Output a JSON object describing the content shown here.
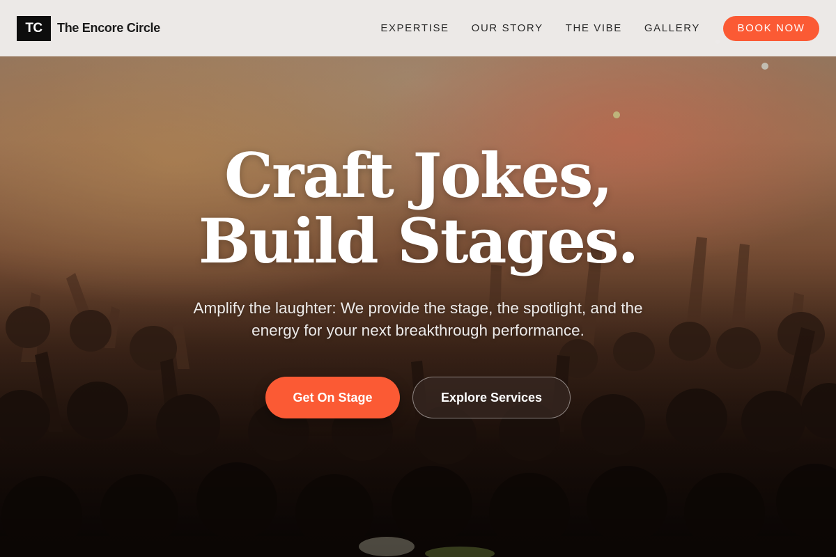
{
  "header": {
    "logo_initials": "TC",
    "brand_name": "The Encore Circle",
    "nav": [
      {
        "label": "EXPERTISE"
      },
      {
        "label": "OUR STORY"
      },
      {
        "label": "THE VIBE"
      },
      {
        "label": "GALLERY"
      }
    ],
    "cta_label": "BOOK NOW"
  },
  "hero": {
    "headline_line1": "Craft Jokes,",
    "headline_line2": "Build Stages.",
    "subtext": "Amplify the laughter: We provide the stage, the spotlight, and the energy for your next breakthrough performance.",
    "primary_button": "Get On Stage",
    "secondary_button": "Explore Services",
    "background_image": "concert-crowd-with-raised-hands"
  },
  "colors": {
    "accent": "#fb5a34",
    "header_bg": "#eeeceb",
    "logo_bg": "#0d0d0d"
  }
}
